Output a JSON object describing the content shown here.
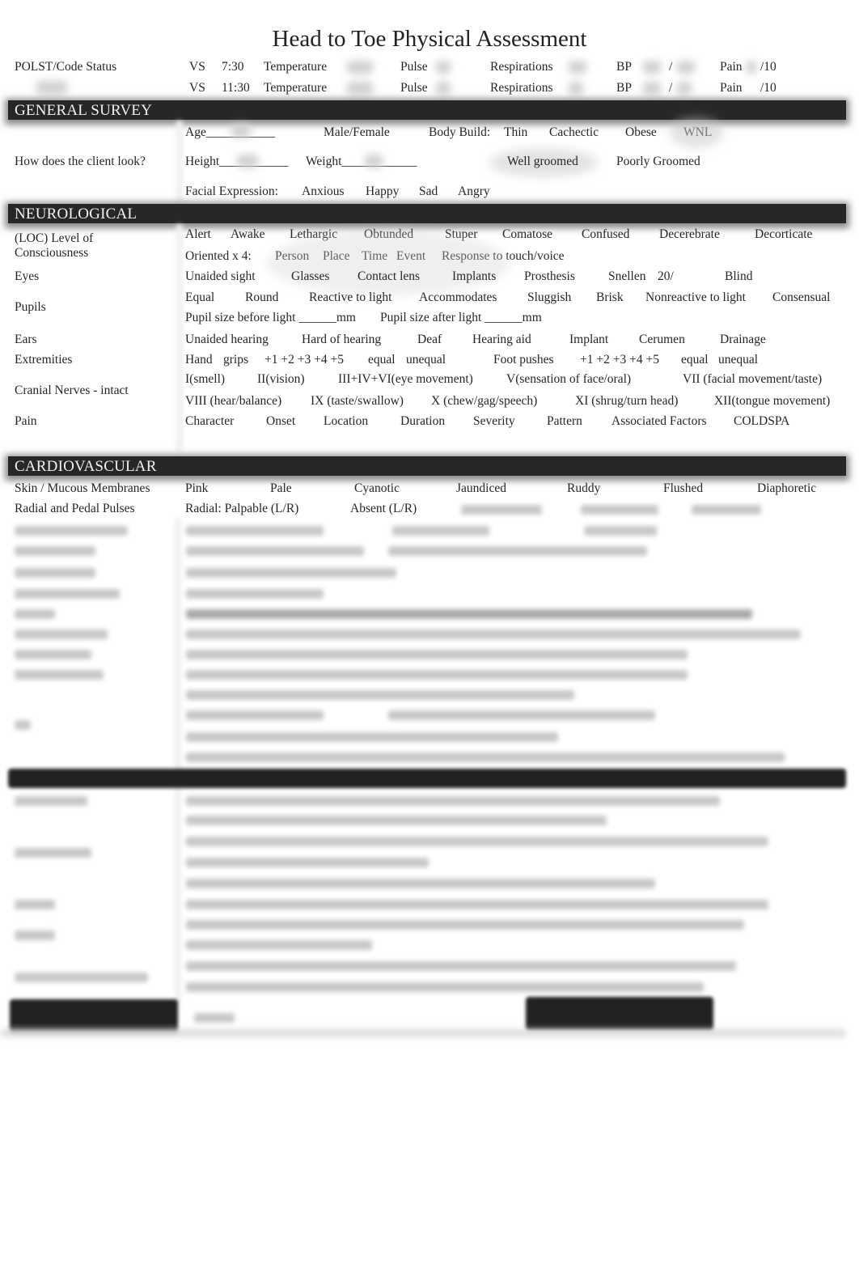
{
  "title": "Head to Toe Physical Assessment",
  "vitals": {
    "polst_label": "POLST/Code Status",
    "rows": [
      {
        "vs": "VS",
        "time": "7:30",
        "temp_label": "Temperature",
        "pulse_label": "Pulse",
        "resp_label": "Respirations",
        "bp_label": "BP",
        "bp_sep": "/",
        "pain_label": "Pain",
        "pain_suffix": "/10"
      },
      {
        "vs": "VS",
        "time": "11:30",
        "temp_label": "Temperature",
        "pulse_label": "Pulse",
        "resp_label": "Respirations",
        "bp_label": "BP",
        "bp_sep": "/",
        "pain_label": "Pain",
        "pain_suffix": "/10"
      }
    ]
  },
  "general_survey": {
    "header": "GENERAL SURVEY",
    "label": "How does the client look?",
    "age": "Age___________",
    "sex": "Male/Female",
    "body_build_label": "Body Build:",
    "body_build_options": [
      "Thin",
      "Cachectic",
      "Obese",
      "WNL"
    ],
    "height": "Height___________",
    "weight": "Weight____________",
    "grooming_options": [
      "Well groomed",
      "Poorly Groomed"
    ],
    "facial_label": "Facial Expression:",
    "facial_options": [
      "Anxious",
      "Happy",
      "Sad",
      "Angry"
    ]
  },
  "neurological": {
    "header": "NEUROLOGICAL",
    "loc_label_1": "(LOC) Level of",
    "loc_label_2": "Consciousness",
    "loc_options": [
      "Alert",
      "Awake",
      "Lethargic",
      "Obtunded",
      "Stuper",
      "Comatose",
      "Confused",
      "Decerebrate",
      "Decorticate"
    ],
    "oriented_label": "Oriented x 4:",
    "oriented_options": [
      "Person",
      "Place",
      "Time",
      "Event",
      "Response to touch/voice"
    ],
    "eyes_label": "Eyes",
    "eyes_options": [
      "Unaided sight",
      "Glasses",
      "Contact lens",
      "Implants",
      "Prosthesis",
      "Snellen",
      "20/",
      "Blind"
    ],
    "pupils_label": "Pupils",
    "pupils_options": [
      "Equal",
      "Round",
      "Reactive to light",
      "Accommodates",
      "Sluggish",
      "Brisk",
      "Nonreactive to light",
      "Consensual"
    ],
    "pupil_before": "Pupil size before light ______mm",
    "pupil_after": "Pupil size after light ______mm",
    "ears_label": "Ears",
    "ears_options": [
      "Unaided hearing",
      "Hard of hearing",
      "Deaf",
      "Hearing aid",
      "Implant",
      "Cerumen",
      "Drainage"
    ],
    "extremities_label": "Extremities",
    "extremities": [
      "Hand",
      "grips",
      "+1 +2 +3 +4 +5",
      "equal",
      "unequal",
      "Foot pushes",
      "+1 +2 +3 +4 +5",
      "equal",
      "unequal"
    ],
    "cranial_label": "Cranial Nerves - intact",
    "cranial_row1": [
      "I(smell)",
      "II(vision)",
      "III+IV+VI(eye movement)",
      "V(sensation of face/oral)",
      "VII (facial movement/taste)"
    ],
    "cranial_row2": [
      "VIII (hear/balance)",
      "IX (taste/swallow)",
      "X (chew/gag/speech)",
      "XI (shrug/turn head)",
      "XII(tongue movement)"
    ],
    "pain_label": "Pain",
    "pain_options": [
      "Character",
      "Onset",
      "Location",
      "Duration",
      "Severity",
      "Pattern",
      "Associated Factors",
      "COLDSPA"
    ]
  },
  "cardiovascular": {
    "header": "CARDIOVASCULAR",
    "skin_label": "Skin / Mucous Membranes",
    "skin_options": [
      "Pink",
      "Pale",
      "Cyanotic",
      "Jaundiced",
      "Ruddy",
      "Flushed",
      "Diaphoretic"
    ],
    "pulses_label": "Radial and Pedal Pulses",
    "pulses_options": [
      "Radial: Palpable (L/R)",
      "Absent (L/R)"
    ]
  }
}
